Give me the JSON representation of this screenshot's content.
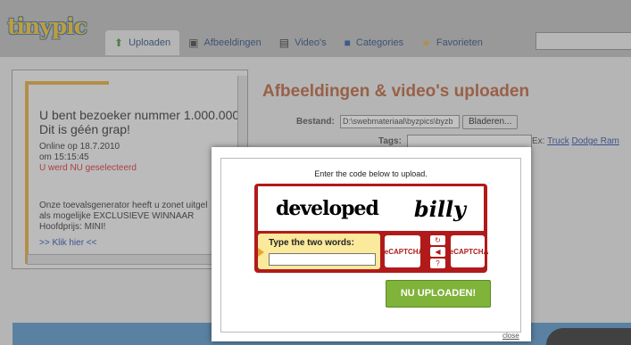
{
  "header": {
    "logo": "tinypic",
    "tabs": [
      {
        "label": "Uploaden",
        "icon": "up-arrow-icon"
      },
      {
        "label": "Afbeeldingen",
        "icon": "images-icon"
      },
      {
        "label": "Video's",
        "icon": "film-icon"
      },
      {
        "label": "Categories",
        "icon": "folder-icon"
      },
      {
        "label": "Favorieten",
        "icon": "star-icon"
      }
    ]
  },
  "promo": {
    "line1": "U bent bezoeker nummer 1.000.000",
    "line2": "Dit is géén grap!",
    "online": "Online op 18.7.2010",
    "time": "om 15:15:45",
    "selected": "U werd NU geselecteerd",
    "text1": "Onze toevalsgenerator heeft u zonet uitgel",
    "text2": "als mogelijke EXCLUSIEVE WINNAAR",
    "text3": "Hoofdprijs: MINI!",
    "link": ">> Klik hier <<"
  },
  "upload": {
    "title": "Afbeeldingen & video's uploaden",
    "bestand_label": "Bestand:",
    "file_value": "D:\\swebmateriaal\\byzpics\\byzb",
    "browse_label": "Bladeren...",
    "tags_label": "Tags:",
    "example_prefix": "Ex:",
    "example1": "Truck",
    "example2": "Dodge Ram"
  },
  "modal": {
    "prompt": "Enter the code below to upload.",
    "word1": "developed",
    "word2": "billy",
    "input_label": "Type the two words:",
    "logo_text": "reCAPTCHA",
    "submit_label": "NU UPLOADEN!",
    "close_label": "close"
  },
  "colors": {
    "accent_red": "#b11a1a",
    "submit_green": "#7fb33a",
    "title_orange": "#b7572e"
  }
}
